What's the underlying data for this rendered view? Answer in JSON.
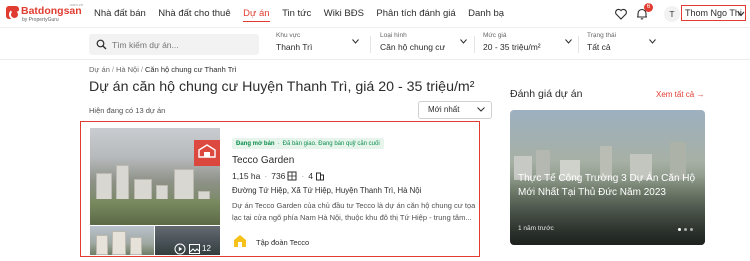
{
  "header": {
    "logo_text": "Batdongsan",
    "logo_domain": ".com.vn",
    "logo_sub": "by PropertyGuru",
    "nav": [
      {
        "label": "Nhà đất bán"
      },
      {
        "label": "Nhà đất cho thuê"
      },
      {
        "label": "Dự án"
      },
      {
        "label": "Tin tức"
      },
      {
        "label": "Wiki BĐS"
      },
      {
        "label": "Phân tích đánh giá"
      },
      {
        "label": "Danh bạ"
      }
    ],
    "active_nav": "Dự án",
    "notification_count": "6",
    "avatar_initial": "T",
    "user_name": "Thom Ngo Thi",
    "accent_color": "#e03c31",
    "icons": [
      "heart-icon",
      "bell-icon"
    ]
  },
  "filters": {
    "search_placeholder": "Tìm kiếm dự án...",
    "items": [
      {
        "label": "Khu vực",
        "value": "Thanh Trì"
      },
      {
        "label": "Loại hình",
        "value": "Căn hộ chung cư"
      },
      {
        "label": "Mức giá",
        "value": "20 - 35 triệu/m²"
      },
      {
        "label": "Trạng thái",
        "value": "Tất cả"
      }
    ]
  },
  "breadcrumb": [
    "Dự án",
    "Hà Nội",
    "Căn hộ chung cư Thanh Trì"
  ],
  "page_title": "Dự án căn hộ chung cư Huyện Thanh Trì, giá 20 - 35 triệu/m²",
  "result_count": "Hiện đang có 13 dự án",
  "sort": {
    "value": "Mới nhất"
  },
  "project": {
    "status": "Đang mở bán",
    "status_detail": "Đã bàn giao. Đang bán quỹ căn cuối",
    "name": "Tecco Garden",
    "area": "1,15 ha",
    "units": "736",
    "buildings": "4",
    "address": "Đường Tứ Hiệp, Xã Tứ Hiệp, Huyện Thanh Trì, Hà Nội",
    "description": "Dự án Tecco Garden của chủ đầu tư Tecco là dự án căn hộ chung cư tọa lạc tại cửa ngõ phía Nam Hà Nội, thuộc khu đô thị Tứ Hiệp - trung tâm...",
    "media_count": "12",
    "developer": "Tập đoàn Tecco",
    "status_color": "#0b8e4b"
  },
  "sidebar": {
    "title": "Đánh giá dự án",
    "see_all": "Xem tất cả",
    "review": {
      "title": "Thực Tế Công Trường 3 Dự Án Căn Hộ Mới Nhất Tại Thủ Đức Năm 2023",
      "time": "1 năm trước"
    }
  }
}
